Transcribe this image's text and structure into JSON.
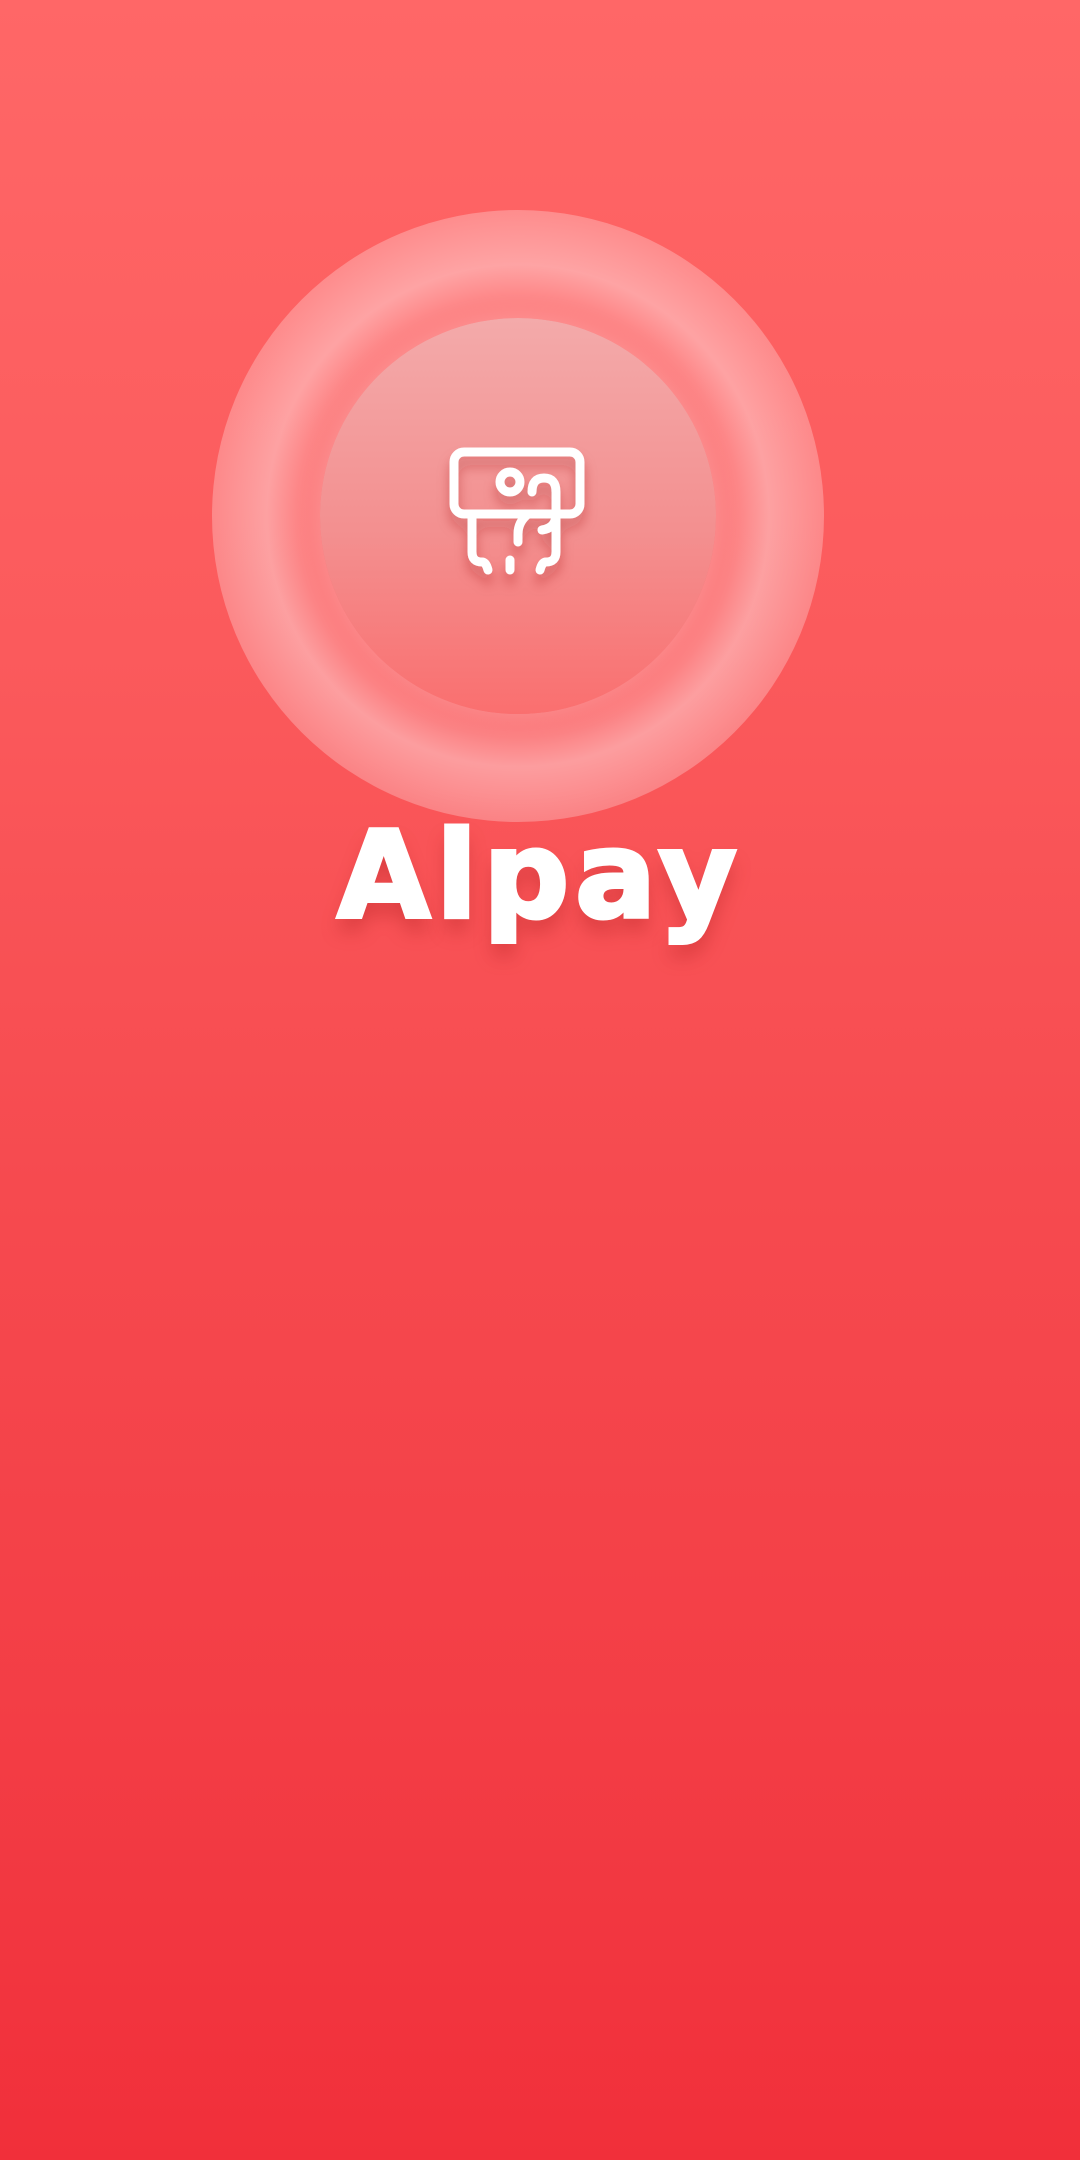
{
  "app": {
    "name": "Alpay",
    "icon": "receipt-question-icon"
  },
  "theme": {
    "background_top": "#ff6767",
    "background_bottom": "#f12f3a",
    "accent": "#ffffff"
  }
}
